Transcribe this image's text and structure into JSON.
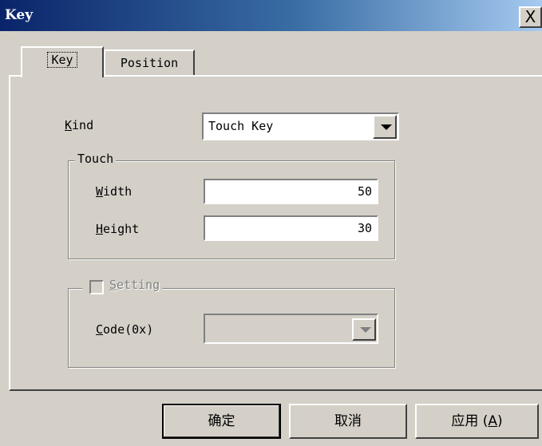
{
  "window": {
    "title": "Key",
    "close_label": "X"
  },
  "tabs": [
    {
      "label": "Key",
      "active": true
    },
    {
      "label": "Position",
      "active": false
    }
  ],
  "kind": {
    "mnemonic": "K",
    "label_rest": "ind",
    "value": "Touch Key"
  },
  "touch_group": {
    "legend": "Touch",
    "width": {
      "mnemonic": "W",
      "label_rest": "idth",
      "value": "50"
    },
    "height": {
      "mnemonic": "H",
      "label_rest": "eight",
      "value": "30"
    }
  },
  "setting_group": {
    "mnemonic": "S",
    "legend_rest": "etting",
    "checked": false,
    "enabled": false,
    "code": {
      "mnemonic": "C",
      "label_rest": "ode(0x)",
      "value": ""
    }
  },
  "buttons": {
    "ok": "确定",
    "cancel": "取消",
    "apply_prefix": "应用 (",
    "apply_mnemonic": "A",
    "apply_suffix": ")"
  }
}
